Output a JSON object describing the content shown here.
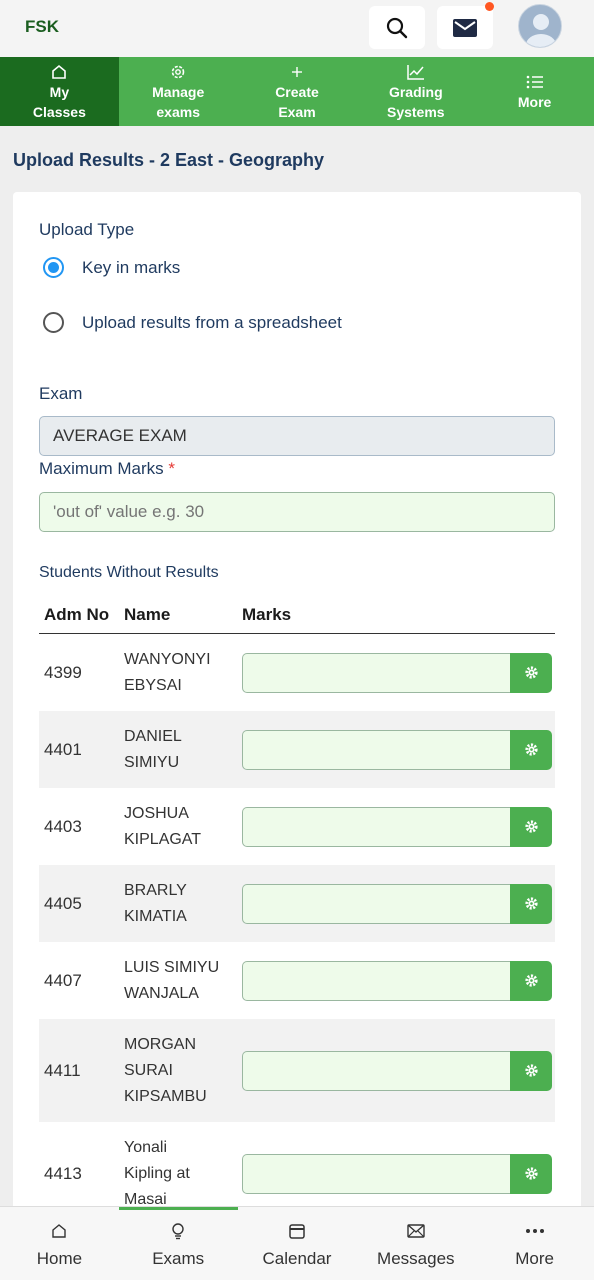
{
  "header": {
    "brand": "FSK",
    "has_notification": true
  },
  "nav": {
    "items": [
      {
        "label_line1": "My",
        "label_line2": "Classes",
        "icon": "home-icon",
        "active": true
      },
      {
        "label_line1": "Manage",
        "label_line2": "exams",
        "icon": "gear-icon"
      },
      {
        "label_line1": "Create",
        "label_line2": "Exam",
        "icon": "plus-icon"
      },
      {
        "label_line1": "Grading",
        "label_line2": "Systems",
        "icon": "trend-chart-icon"
      },
      {
        "label_line1": "More",
        "label_line2": "",
        "icon": "list-icon"
      }
    ]
  },
  "page": {
    "title": "Upload Results - 2 East - Geography"
  },
  "form": {
    "upload_type_label": "Upload Type",
    "option_key_in": "Key in marks",
    "option_spreadsheet": "Upload results from a spreadsheet",
    "selected_option": "Key in marks",
    "exam_label": "Exam",
    "exam_value": "AVERAGE EXAM",
    "max_marks_label": "Maximum Marks",
    "required_mark": "*",
    "max_marks_placeholder": "'out of' value e.g. 30",
    "students_heading": "Students Without Results"
  },
  "table": {
    "headers": {
      "adm": "Adm No",
      "name": "Name",
      "marks": "Marks"
    },
    "rows": [
      {
        "adm": "4399",
        "name_lines": [
          "WANYONYI",
          "EBYSAI"
        ]
      },
      {
        "adm": "4401",
        "name_lines": [
          "DANIEL",
          "SIMIYU"
        ]
      },
      {
        "adm": "4403",
        "name_lines": [
          "JOSHUA",
          "KIPLAGAT"
        ]
      },
      {
        "adm": "4405",
        "name_lines": [
          "BRARLY",
          "KIMATIA"
        ]
      },
      {
        "adm": "4407",
        "name_lines": [
          "LUIS SIMIYU",
          "WANJALA"
        ]
      },
      {
        "adm": "4411",
        "name_lines": [
          "MORGAN",
          "SURAI",
          "KIPSAMBU"
        ]
      },
      {
        "adm": "4413",
        "name_lines": [
          "Yonali",
          "Kipling at",
          "Masai"
        ]
      }
    ]
  },
  "bottom_nav": {
    "items": [
      {
        "label": "Home",
        "icon": "home-icon"
      },
      {
        "label": "Exams",
        "icon": "lightbulb-icon",
        "active": true
      },
      {
        "label": "Calendar",
        "icon": "calendar-icon"
      },
      {
        "label": "Messages",
        "icon": "envelope-icon"
      },
      {
        "label": "More",
        "icon": "more-dots-icon"
      }
    ]
  },
  "colors": {
    "primary_green": "#4caf50",
    "dark_green": "#1b6b1f",
    "radio_blue": "#2196f3",
    "required_red": "#e53935"
  }
}
